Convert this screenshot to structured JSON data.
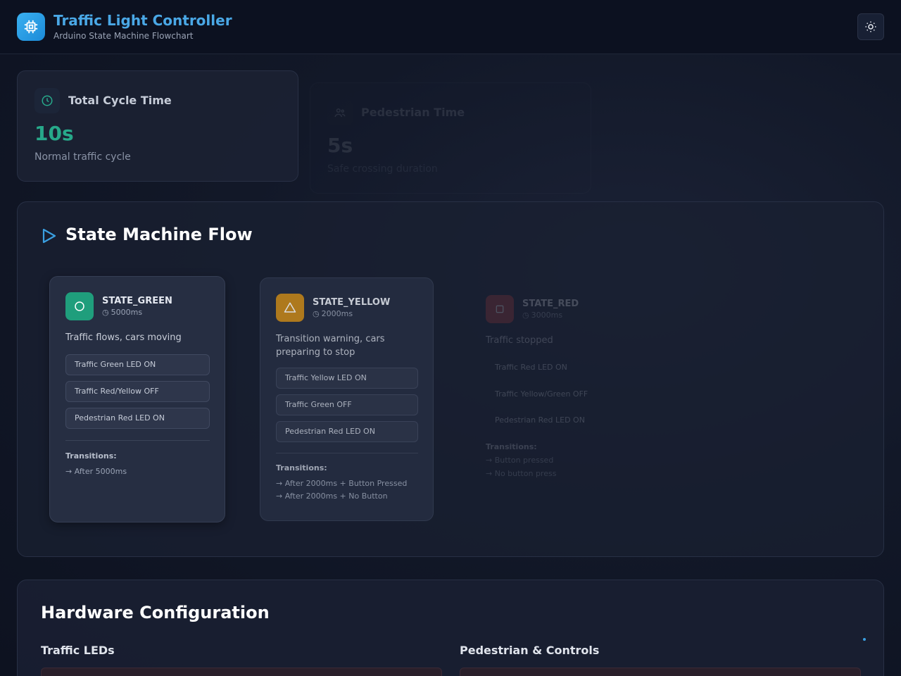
{
  "header": {
    "title": "Traffic Light Controller",
    "subtitle": "Arduino State Machine Flowchart",
    "logo_icon": "chip-icon",
    "theme_icon": "sun-icon"
  },
  "stats": [
    {
      "label": "Total Cycle Time",
      "value": "10s",
      "desc": "Normal traffic cycle",
      "icon": "clock-icon"
    },
    {
      "label": "Pedestrian Time",
      "value": "5s",
      "desc": "Safe crossing duration",
      "icon": "users-icon"
    }
  ],
  "flow": {
    "title": "State Machine Flow",
    "icon": "play-icon",
    "states": [
      {
        "name": "STATE_GREEN",
        "time": "5000ms",
        "desc": [
          "Traffic flows, cars moving"
        ],
        "actions": [
          "Traffic Green LED ON",
          "Traffic Red/Yellow OFF",
          "Pedestrian Red LED ON"
        ],
        "transitions_label": "Transitions:",
        "transitions": [
          "→ After 5000ms"
        ],
        "color": "#1f9e7c",
        "icon": "circle-icon"
      },
      {
        "name": "STATE_YELLOW",
        "time": "2000ms",
        "desc": [
          "Transition warning, cars",
          "preparing to stop"
        ],
        "actions": [
          "Traffic Yellow LED ON",
          "Traffic Green OFF",
          "Pedestrian Red LED ON"
        ],
        "transitions_label": "Transitions:",
        "transitions": [
          "→ After 2000ms + Button Pressed",
          "→ After 2000ms + No Button"
        ],
        "color": "#c98a1a",
        "icon": "warning-icon"
      },
      {
        "name": "STATE_RED",
        "time": "3000ms",
        "desc": [
          "Traffic stopped"
        ],
        "actions": [
          "Traffic Red LED ON",
          "Traffic Yellow/Green OFF",
          "Pedestrian Red LED ON"
        ],
        "transitions_label": "Transitions:",
        "transitions": [
          "→ Button pressed",
          "→ No button press"
        ],
        "color": "#b03a3a",
        "icon": "square-icon"
      }
    ]
  },
  "hardware": {
    "title": "Hardware Configuration",
    "columns": [
      "Traffic LEDs",
      "Pedestrian & Controls"
    ]
  }
}
